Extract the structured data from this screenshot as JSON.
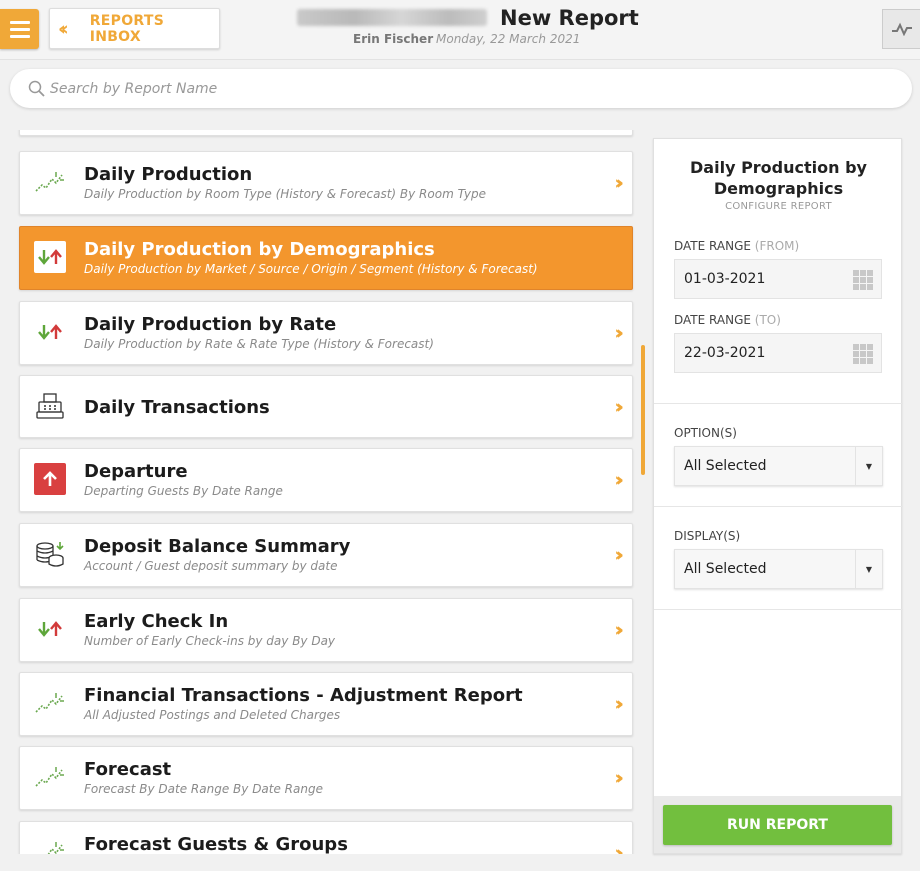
{
  "header": {
    "menu_icon": "hamburger-icon",
    "back_label": "REPORTS INBOX",
    "title": "New Report",
    "user": "Erin Fischer",
    "date": "Monday, 22 March 2021"
  },
  "search": {
    "placeholder": "Search by Report Name"
  },
  "reports": [
    {
      "title": "Daily Production",
      "subtitle": "Daily Production by Room Type (History & Forecast) By Room Type",
      "icon": "trend-chart-icon",
      "active": false
    },
    {
      "title": "Daily Production by Demographics",
      "subtitle": "Daily Production by Market / Source / Origin / Segment (History & Forecast)",
      "icon": "up-down-arrows-icon",
      "active": true
    },
    {
      "title": "Daily Production by Rate",
      "subtitle": "Daily Production by Rate & Rate Type (History & Forecast)",
      "icon": "up-down-arrows-icon",
      "active": false
    },
    {
      "title": "Daily Transactions",
      "subtitle": "",
      "icon": "cash-register-icon",
      "active": false
    },
    {
      "title": "Departure",
      "subtitle": "Departing Guests By Date Range",
      "icon": "departure-arrow-icon",
      "active": false
    },
    {
      "title": "Deposit Balance Summary",
      "subtitle": "Account / Guest deposit summary by date",
      "icon": "coins-icon",
      "active": false
    },
    {
      "title": "Early Check In",
      "subtitle": "Number of Early Check-ins by day By Day",
      "icon": "up-down-arrows-icon",
      "active": false
    },
    {
      "title": "Financial Transactions - Adjustment Report",
      "subtitle": "All Adjusted Postings and Deleted Charges",
      "icon": "trend-chart-icon",
      "active": false
    },
    {
      "title": "Forecast",
      "subtitle": "Forecast By Date Range By Date Range",
      "icon": "trend-chart-icon",
      "active": false
    },
    {
      "title": "Forecast Guests & Groups",
      "subtitle": "",
      "icon": "trend-chart-icon",
      "active": false
    }
  ],
  "config": {
    "title": "Daily Production by Demographics",
    "subtitle": "CONFIGURE REPORT",
    "from_label": "DATE RANGE",
    "from_hint": "(FROM)",
    "from_value": "01-03-2021",
    "to_label": "DATE RANGE",
    "to_hint": "(TO)",
    "to_value": "22-03-2021",
    "options_label": "OPTION(S)",
    "options_value": "All Selected",
    "displays_label": "DISPLAY(S)",
    "displays_value": "All Selected",
    "run_label": "RUN REPORT"
  },
  "colors": {
    "accent": "#f0a838",
    "active_row": "#f3962d",
    "run_button": "#72bf3e"
  }
}
